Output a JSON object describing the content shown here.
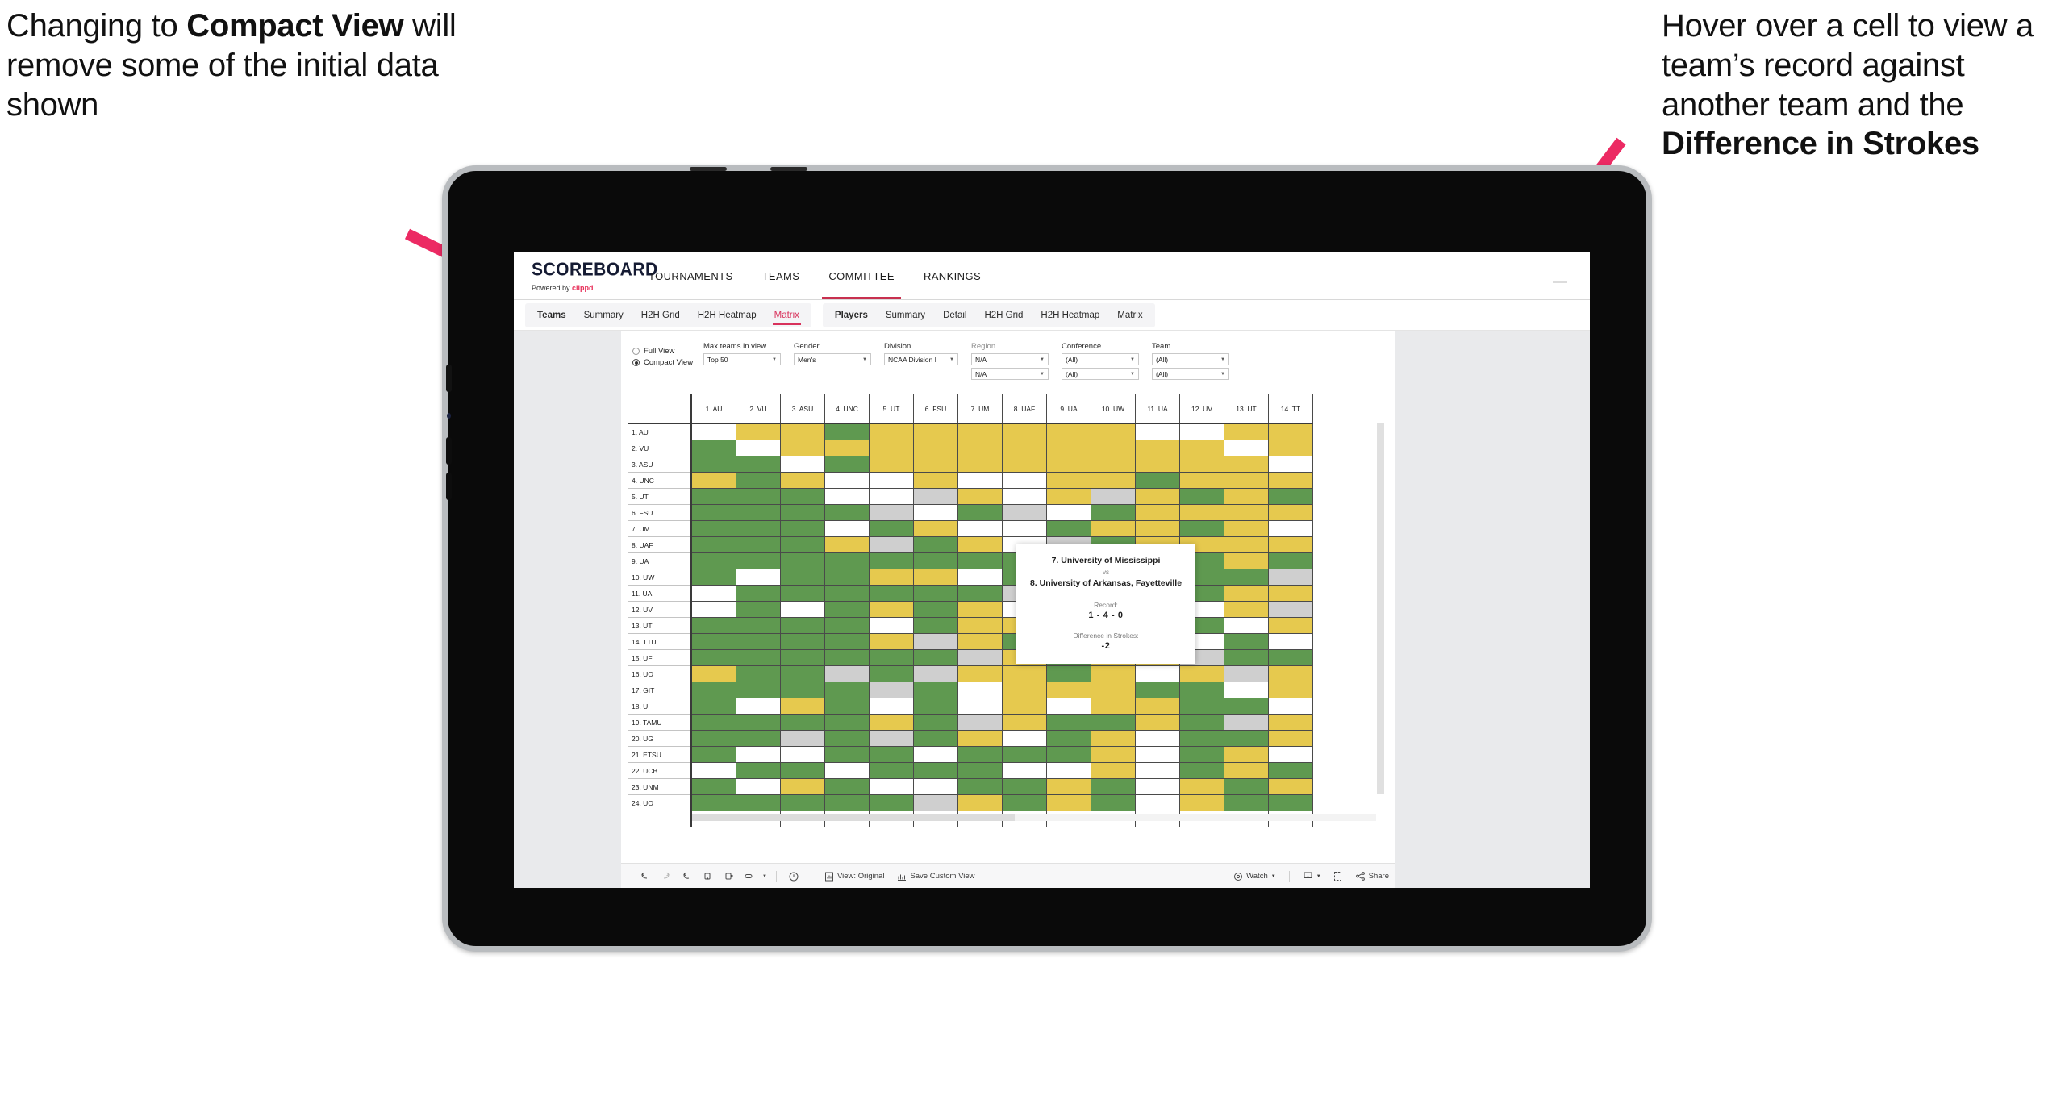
{
  "annotations": {
    "left": {
      "line1": "Changing to",
      "bold": "Compact View",
      "line2": " will remove some of the initial data shown"
    },
    "right": {
      "line1": "Hover over a cell to view a team’s record against another team and the ",
      "bold": "Difference in Strokes"
    },
    "arrow_color": "#ec2a63"
  },
  "app": {
    "logo": {
      "wordmark": "SCOREBOARD",
      "powered_prefix": "Powered by ",
      "brand": "clippd"
    },
    "top_nav": [
      {
        "label": "TOURNAMENTS",
        "active": false
      },
      {
        "label": "TEAMS",
        "active": false
      },
      {
        "label": "COMMITTEE",
        "active": true
      },
      {
        "label": "RANKINGS",
        "active": false
      }
    ],
    "sub_nav": {
      "teams_group": [
        {
          "label": "Teams",
          "head": true,
          "active": false
        },
        {
          "label": "Summary",
          "head": false,
          "active": false
        },
        {
          "label": "H2H Grid",
          "head": false,
          "active": false
        },
        {
          "label": "H2H Heatmap",
          "head": false,
          "active": false
        },
        {
          "label": "Matrix",
          "head": false,
          "active": true
        }
      ],
      "players_group": [
        {
          "label": "Players",
          "head": true,
          "active": false
        },
        {
          "label": "Summary",
          "head": false,
          "active": false
        },
        {
          "label": "Detail",
          "head": false,
          "active": false
        },
        {
          "label": "H2H Grid",
          "head": false,
          "active": false
        },
        {
          "label": "H2H Heatmap",
          "head": false,
          "active": false
        },
        {
          "label": "Matrix",
          "head": false,
          "active": false
        }
      ]
    },
    "filters": {
      "view_mode": {
        "options": [
          {
            "label": "Full View",
            "selected": false
          },
          {
            "label": "Compact View",
            "selected": true
          }
        ]
      },
      "max_teams": {
        "label": "Max teams in view",
        "value": "Top 50"
      },
      "gender": {
        "label": "Gender",
        "value": "Men's"
      },
      "division": {
        "label": "Division",
        "value": "NCAA Division I"
      },
      "region": {
        "label": "Region",
        "value1": "N/A",
        "value2": "N/A"
      },
      "conference": {
        "label": "Conference",
        "value1": "(All)",
        "value2": "(All)"
      },
      "team": {
        "label": "Team",
        "value1": "(All)",
        "value2": "(All)"
      }
    },
    "tooltip": {
      "team_a": "7. University of Mississippi",
      "vs": "vs",
      "team_b": "8. University of Arkansas, Fayetteville",
      "record_label": "Record:",
      "record_value": "1 - 4 - 0",
      "strokes_label": "Difference in Strokes:",
      "strokes_value": "-2"
    },
    "toolbar": {
      "icons": [
        "undo-icon",
        "redo-icon",
        "revert-icon",
        "refresh-icon",
        "pause-icon",
        "zoom-icon"
      ],
      "alert_icon": "alert-icon",
      "view_label": "View: Original",
      "save_label": "Save Custom View",
      "watch_label": "Watch",
      "download_icon": "download-icon",
      "fullscreen_icon": "fullscreen-icon",
      "share_label": "Share"
    }
  },
  "chart_data": {
    "type": "heatmap",
    "title": "Team Head-to-Head Matrix",
    "colors": {
      "win": "#5f9950",
      "loss": "#e6c94e",
      "tie": "#cfcfcf",
      "none": "#ffffff"
    },
    "legend": [
      "win",
      "loss",
      "tie",
      "no-data"
    ],
    "columns": [
      "1. AU",
      "2. VU",
      "3. ASU",
      "4. UNC",
      "5. UT",
      "6. FSU",
      "7. UM",
      "8. UAF",
      "9. UA",
      "10. UW",
      "11. UA",
      "12. UV",
      "13. UT",
      "14. TT"
    ],
    "rows": [
      "1. AU",
      "2. VU",
      "3. ASU",
      "4. UNC",
      "5. UT",
      "6. FSU",
      "7. UM",
      "8. UAF",
      "9. UA",
      "10. UW",
      "11. UA",
      "12. UV",
      "13. UT",
      "14. TTU",
      "15. UF",
      "16. UO",
      "17. GIT",
      "18. UI",
      "19. TAMU",
      "20. UG",
      "21. ETSU",
      "22. UCB",
      "23. UNM",
      "24. UO"
    ],
    "matrix": [
      [
        "w",
        "y",
        "y",
        "g",
        "y",
        "y",
        "y",
        "y",
        "y",
        "y",
        "w",
        "w",
        "y",
        "y"
      ],
      [
        "g",
        "w",
        "y",
        "y",
        "y",
        "y",
        "y",
        "y",
        "y",
        "y",
        "y",
        "y",
        "w",
        "y"
      ],
      [
        "g",
        "g",
        "w",
        "g",
        "y",
        "y",
        "y",
        "y",
        "y",
        "y",
        "y",
        "y",
        "y",
        "w"
      ],
      [
        "y",
        "g",
        "y",
        "w",
        "w",
        "y",
        "w",
        "w",
        "y",
        "y",
        "g",
        "y",
        "y",
        "y"
      ],
      [
        "g",
        "g",
        "g",
        "w",
        "w",
        "x",
        "y",
        "w",
        "y",
        "x",
        "y",
        "g",
        "y",
        "g"
      ],
      [
        "g",
        "g",
        "g",
        "g",
        "x",
        "w",
        "g",
        "x",
        "w",
        "g",
        "y",
        "y",
        "y",
        "y"
      ],
      [
        "g",
        "g",
        "g",
        "w",
        "g",
        "y",
        "w",
        "w",
        "g",
        "y",
        "y",
        "g",
        "y",
        "w"
      ],
      [
        "g",
        "g",
        "g",
        "y",
        "x",
        "g",
        "y",
        "w",
        "x",
        "g",
        "y",
        "y",
        "y",
        "y"
      ],
      [
        "g",
        "g",
        "g",
        "g",
        "g",
        "g",
        "g",
        "g",
        "w",
        "g",
        "g",
        "g",
        "y",
        "g"
      ],
      [
        "g",
        "w",
        "g",
        "g",
        "y",
        "y",
        "w",
        "g",
        "w",
        "w",
        "y",
        "g",
        "g",
        "x"
      ],
      [
        "w",
        "g",
        "g",
        "g",
        "g",
        "g",
        "g",
        "x",
        "y",
        "y",
        "w",
        "g",
        "y",
        "y"
      ],
      [
        "w",
        "g",
        "w",
        "g",
        "y",
        "g",
        "y",
        "w",
        "g",
        "w",
        "y",
        "w",
        "y",
        "x"
      ],
      [
        "g",
        "g",
        "g",
        "g",
        "w",
        "g",
        "y",
        "y",
        "w",
        "g",
        "y",
        "g",
        "w",
        "y"
      ],
      [
        "g",
        "g",
        "g",
        "g",
        "y",
        "x",
        "y",
        "g",
        "y",
        "g",
        "g",
        "w",
        "g",
        "w"
      ],
      [
        "g",
        "g",
        "g",
        "g",
        "g",
        "g",
        "x",
        "y",
        "g",
        "y",
        "y",
        "x",
        "g",
        "g"
      ],
      [
        "y",
        "g",
        "g",
        "x",
        "g",
        "x",
        "y",
        "y",
        "g",
        "y",
        "w",
        "y",
        "x",
        "y"
      ],
      [
        "g",
        "g",
        "g",
        "g",
        "x",
        "g",
        "w",
        "y",
        "y",
        "y",
        "g",
        "g",
        "w",
        "y"
      ],
      [
        "g",
        "w",
        "y",
        "g",
        "w",
        "g",
        "w",
        "y",
        "w",
        "y",
        "y",
        "g",
        "g",
        "w"
      ],
      [
        "g",
        "g",
        "g",
        "g",
        "y",
        "g",
        "x",
        "y",
        "g",
        "g",
        "y",
        "g",
        "x",
        "y"
      ],
      [
        "g",
        "g",
        "x",
        "g",
        "x",
        "g",
        "y",
        "w",
        "g",
        "y",
        "w",
        "g",
        "g",
        "y"
      ],
      [
        "g",
        "w",
        "w",
        "g",
        "g",
        "w",
        "g",
        "g",
        "g",
        "y",
        "w",
        "g",
        "y",
        "w"
      ],
      [
        "w",
        "g",
        "g",
        "w",
        "g",
        "g",
        "g",
        "w",
        "w",
        "y",
        "w",
        "g",
        "y",
        "g"
      ],
      [
        "g",
        "w",
        "y",
        "g",
        "w",
        "w",
        "g",
        "g",
        "y",
        "g",
        "w",
        "y",
        "g",
        "y"
      ],
      [
        "g",
        "g",
        "g",
        "g",
        "g",
        "x",
        "y",
        "g",
        "y",
        "g",
        "w",
        "y",
        "g",
        "g"
      ]
    ]
  }
}
